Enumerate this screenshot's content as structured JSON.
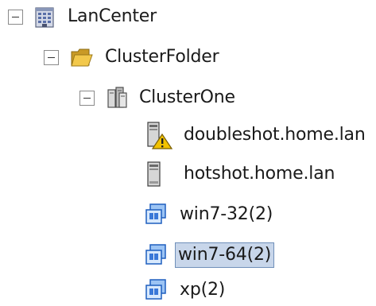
{
  "tree": {
    "root": {
      "label": "LanCenter",
      "icon": "datacenter-icon",
      "expanded": true
    },
    "folder": {
      "label": "ClusterFolder",
      "icon": "folder-icon",
      "expanded": true
    },
    "cluster": {
      "label": "ClusterOne",
      "icon": "cluster-icon",
      "expanded": true
    },
    "hosts": [
      {
        "label": "doubleshot.home.lan",
        "icon": "host-warning-icon",
        "status": "warning"
      },
      {
        "label": "hotshot.home.lan",
        "icon": "host-icon"
      }
    ],
    "vms": [
      {
        "label": "win7-32(2)",
        "icon": "vm-template-icon",
        "selected": false
      },
      {
        "label": "win7-64(2)",
        "icon": "vm-template-icon",
        "selected": true
      },
      {
        "label": "xp(2)",
        "icon": "vm-template-icon",
        "selected": false
      }
    ]
  },
  "colors": {
    "selection_bg": "#c8d6ea",
    "selection_border": "#6f8fb9",
    "folder": "#e8b83a",
    "warning": "#f2c200",
    "vm_blue": "#3a78d8"
  }
}
